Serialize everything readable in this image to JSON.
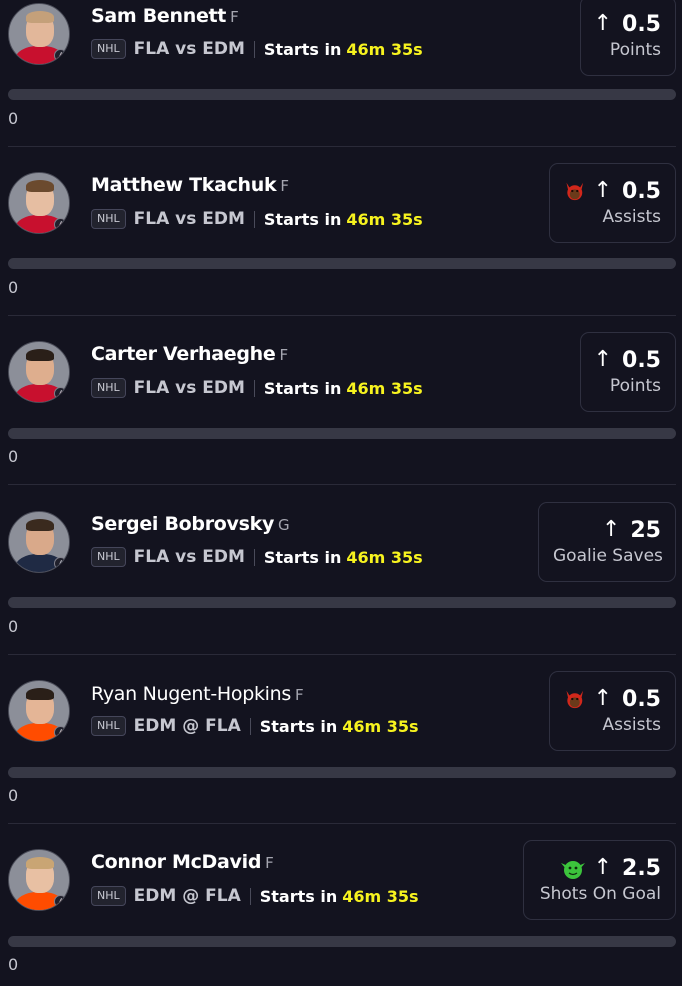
{
  "picks": [
    {
      "name": "Sam Bennett",
      "position": "F",
      "league": "NHL",
      "matchup": "FLA vs EDM",
      "starts_label": "Starts in",
      "countdown": "46m 35s",
      "direction": "↑",
      "line": "0.5",
      "stat": "Points",
      "boost": "none",
      "progress_value": "0",
      "progress_fraction": 0,
      "jersey_color": "#c8102e",
      "hair_color": "#c4a07a"
    },
    {
      "name": "Matthew Tkachuk",
      "position": "F",
      "league": "NHL",
      "matchup": "FLA vs EDM",
      "starts_label": "Starts in",
      "countdown": "46m 35s",
      "direction": "↑",
      "line": "0.5",
      "stat": "Assists",
      "boost": "demon-red",
      "progress_value": "0",
      "progress_fraction": 0,
      "jersey_color": "#c8102e",
      "hair_color": "#6b4a2e"
    },
    {
      "name": "Carter Verhaeghe",
      "position": "F",
      "league": "NHL",
      "matchup": "FLA vs EDM",
      "starts_label": "Starts in",
      "countdown": "46m 35s",
      "direction": "↑",
      "line": "0.5",
      "stat": "Points",
      "boost": "none",
      "progress_value": "0",
      "progress_fraction": 0,
      "jersey_color": "#c8102e",
      "hair_color": "#2a1f18"
    },
    {
      "name": "Sergei Bobrovsky",
      "position": "G",
      "league": "NHL",
      "matchup": "FLA vs EDM",
      "starts_label": "Starts in",
      "countdown": "46m 35s",
      "direction": "↑",
      "line": "25",
      "stat": "Goalie Saves",
      "boost": "none",
      "progress_value": "0",
      "progress_fraction": 0,
      "jersey_color": "#1f2a44",
      "hair_color": "#3a2a1e"
    },
    {
      "name": "Ryan Nugent-Hopkins",
      "position": "F",
      "league": "NHL",
      "matchup": "EDM @ FLA",
      "starts_label": "Starts in",
      "countdown": "46m 35s",
      "direction": "↑",
      "line": "0.5",
      "stat": "Assists",
      "boost": "demon-red",
      "progress_value": "0",
      "progress_fraction": 0,
      "jersey_color": "#ff4c00",
      "hair_color": "#2a1f18"
    },
    {
      "name": "Connor McDavid",
      "position": "F",
      "league": "NHL",
      "matchup": "EDM @ FLA",
      "starts_label": "Starts in",
      "countdown": "46m 35s",
      "direction": "↑",
      "line": "2.5",
      "stat": "Shots On Goal",
      "boost": "goblin-green",
      "progress_value": "0",
      "progress_fraction": 0,
      "jersey_color": "#ff4c00",
      "hair_color": "#c9a574"
    }
  ]
}
